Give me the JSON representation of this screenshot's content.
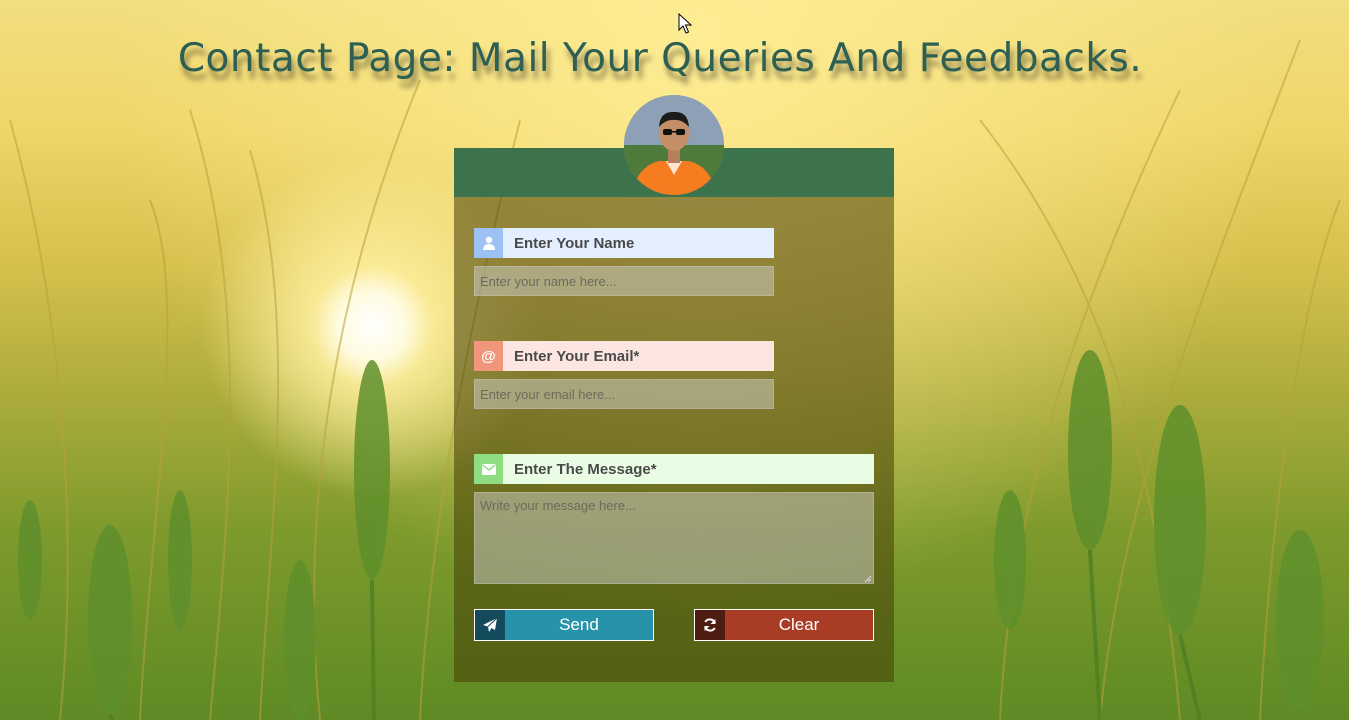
{
  "page": {
    "title": "Contact Page: Mail Your Queries And Feedbacks."
  },
  "form": {
    "name": {
      "label": "Enter Your Name",
      "placeholder": "Enter your name here...",
      "icon": "user-icon",
      "accent": "#9cc1f5",
      "label_bg": "#e3eefe"
    },
    "email": {
      "label": "Enter Your Email*",
      "placeholder": "Enter your email here...",
      "icon": "at-icon",
      "icon_glyph": "@",
      "accent": "#f0977b",
      "label_bg": "#fde6e2"
    },
    "message": {
      "label": "Enter The Message*",
      "placeholder": "Write your message here...",
      "icon": "envelope-icon",
      "accent": "#8fdd82",
      "label_bg": "#e8fde4"
    },
    "send_button": {
      "label": "Send",
      "icon": "paper-plane-icon",
      "color": "#2793ab",
      "icon_bg": "#134a5c"
    },
    "clear_button": {
      "label": "Clear",
      "icon": "refresh-icon",
      "color": "#a83c25",
      "icon_bg": "#4e1c12"
    }
  },
  "colors": {
    "title": "#2d5f52",
    "card_header": "#2d7050"
  }
}
